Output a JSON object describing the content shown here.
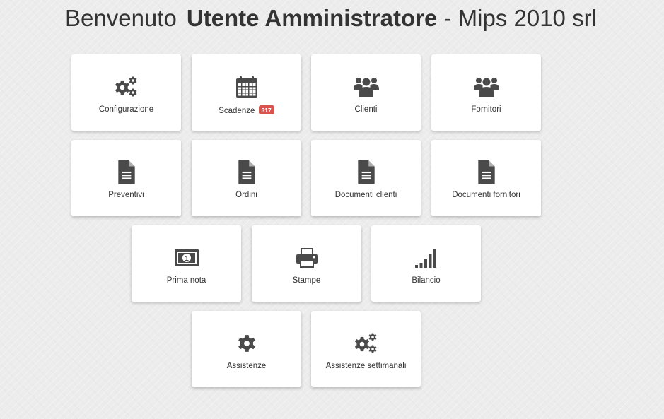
{
  "header": {
    "greeting": "Benvenuto",
    "user": "Utente Amministratore",
    "company": "- Mips 2010 srl"
  },
  "colors": {
    "tile_bg": "#ffffff",
    "icon": "#4a4a4a",
    "badge": "#d9534f"
  },
  "tiles": {
    "configurazione": {
      "label": "Configurazione",
      "icon": "cogs-icon"
    },
    "scadenze": {
      "label": "Scadenze",
      "badge": "317",
      "icon": "calendar-icon"
    },
    "clienti": {
      "label": "Clienti",
      "icon": "users-icon"
    },
    "fornitori": {
      "label": "Fornitori",
      "icon": "users-icon"
    },
    "preventivi": {
      "label": "Preventivi",
      "icon": "document-icon"
    },
    "ordini": {
      "label": "Ordini",
      "icon": "document-icon"
    },
    "documenti_clienti": {
      "label": "Documenti clienti",
      "icon": "document-icon"
    },
    "documenti_fornitori": {
      "label": "Documenti fornitori",
      "icon": "document-icon"
    },
    "prima_nota": {
      "label": "Prima nota",
      "icon": "money-icon"
    },
    "stampe": {
      "label": "Stampe",
      "icon": "print-icon"
    },
    "bilancio": {
      "label": "Bilancio",
      "icon": "signal-icon"
    },
    "assistenze": {
      "label": "Assistenze",
      "icon": "gear-icon"
    },
    "assistenze_settimanali": {
      "label": "Assistenze settimanali",
      "icon": "cogs-icon"
    }
  }
}
